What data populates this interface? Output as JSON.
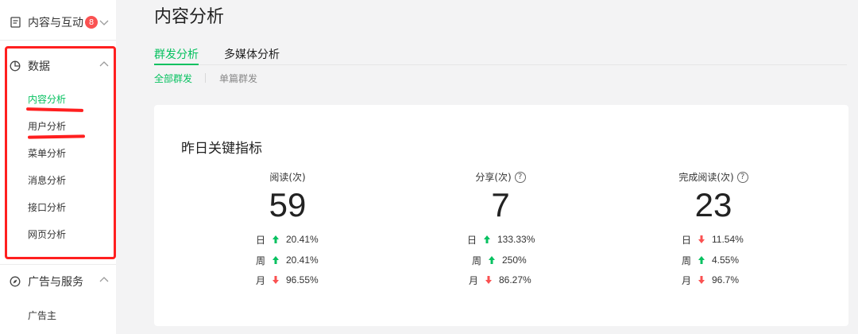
{
  "sidebar": {
    "groups": [
      {
        "label": "内容与互动",
        "badge": "8"
      },
      {
        "label": "数据"
      },
      {
        "label": "广告与服务"
      }
    ],
    "data_items": [
      {
        "label": "内容分析",
        "active": true
      },
      {
        "label": "用户分析"
      },
      {
        "label": "菜单分析"
      },
      {
        "label": "消息分析"
      },
      {
        "label": "接口分析"
      },
      {
        "label": "网页分析"
      }
    ],
    "ad_items": [
      {
        "label": "广告主"
      }
    ]
  },
  "page": {
    "title": "内容分析"
  },
  "tabs": [
    {
      "label": "群发分析",
      "active": true
    },
    {
      "label": "多媒体分析"
    }
  ],
  "subtabs": [
    {
      "label": "全部群发",
      "active": true
    },
    {
      "label": "单篇群发"
    }
  ],
  "card": {
    "title": "昨日关键指标",
    "metrics": [
      {
        "label": "阅读(次)",
        "help": false,
        "value": "59",
        "rows": [
          {
            "period": "日",
            "direction": "up",
            "pct": "20.41%"
          },
          {
            "period": "周",
            "direction": "up",
            "pct": "20.41%"
          },
          {
            "period": "月",
            "direction": "down",
            "pct": "96.55%"
          }
        ]
      },
      {
        "label": "分享(次)",
        "help": true,
        "value": "7",
        "rows": [
          {
            "period": "日",
            "direction": "up",
            "pct": "133.33%"
          },
          {
            "period": "周",
            "direction": "up",
            "pct": "250%"
          },
          {
            "period": "月",
            "direction": "down",
            "pct": "86.27%"
          }
        ]
      },
      {
        "label": "完成阅读(次)",
        "help": true,
        "value": "23",
        "rows": [
          {
            "period": "日",
            "direction": "down",
            "pct": "11.54%"
          },
          {
            "period": "周",
            "direction": "up",
            "pct": "4.55%"
          },
          {
            "period": "月",
            "direction": "down",
            "pct": "96.7%"
          }
        ]
      }
    ]
  },
  "colors": {
    "accent": "#07c160",
    "up": "#07c160",
    "down": "#fa5151",
    "annotation": "#ff1f1f"
  },
  "icons": [
    "document-icon",
    "pie-chart-icon",
    "compass-icon",
    "chevron-down-icon",
    "chevron-up-icon",
    "help-icon",
    "arrow-up-icon",
    "arrow-down-icon"
  ]
}
